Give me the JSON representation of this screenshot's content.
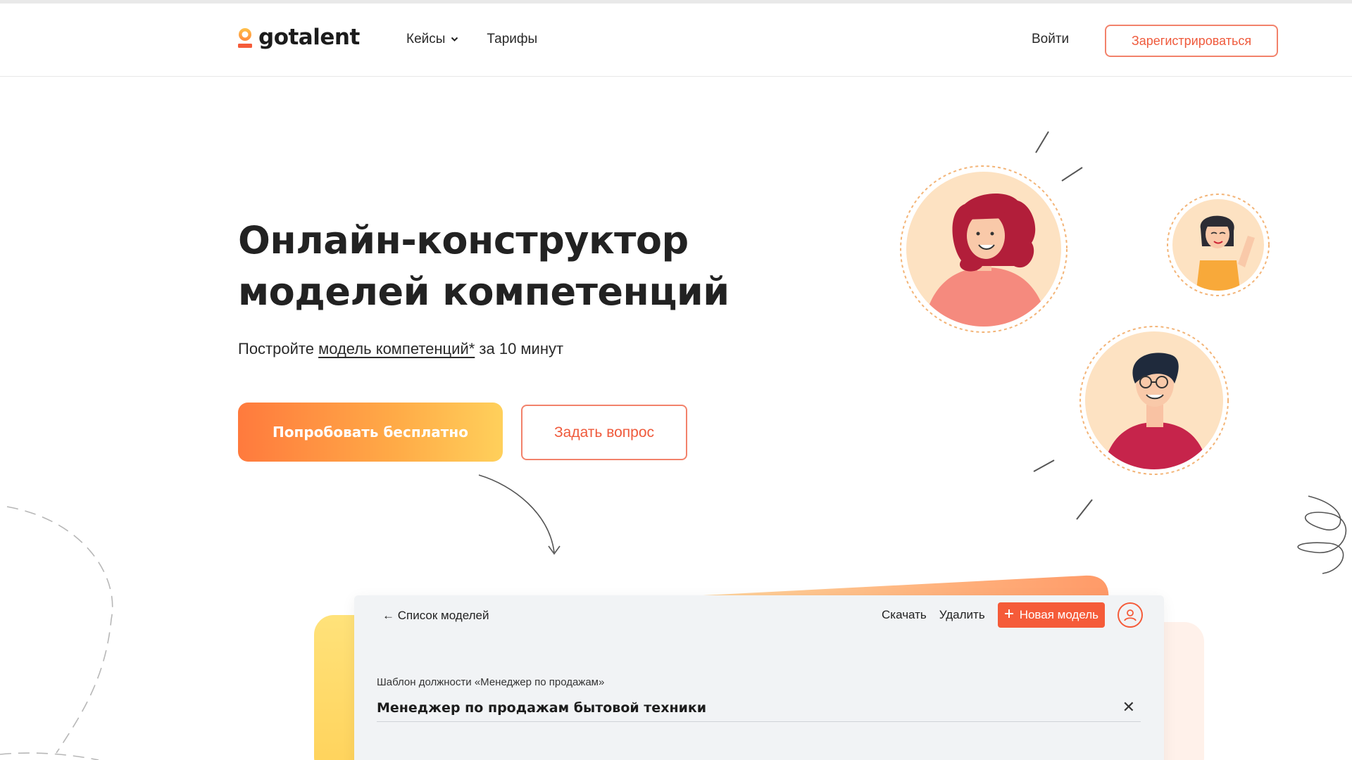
{
  "header": {
    "logo_text": "gotalent",
    "nav": [
      {
        "label": "Кейсы",
        "has_dropdown": true
      },
      {
        "label": "Тарифы",
        "has_dropdown": false
      }
    ],
    "login_label": "Войти",
    "register_label": "Зарегистрироваться"
  },
  "hero": {
    "title_line1": "Онлайн-конструктор",
    "title_line2": "моделей компетенций",
    "subtitle_prefix": "Постройте ",
    "subtitle_link": "модель компетенций*",
    "subtitle_suffix": " за 10 минут",
    "primary_button": "Попробовать бесплатно",
    "secondary_button": "Задать вопрос"
  },
  "app_preview": {
    "back_link": "← Список моделей",
    "download_label": "Скачать",
    "delete_label": "Удалить",
    "new_model_label": "Новая модель",
    "template_label": "Шаблон должности «Менеджер по продажам»",
    "position_value": "Менеджер по продажам бытовой техники",
    "close_symbol": "✕"
  },
  "colors": {
    "accent": "#ef5a3c",
    "accent_border": "#f2826b",
    "gradient_start": "#ff7a3d",
    "gradient_end": "#ffd05b",
    "text_dark": "#222222"
  },
  "icons": [
    "logo-mark-icon",
    "chevron-down-icon",
    "plus-icon",
    "user-icon",
    "close-icon",
    "arrow-left-icon"
  ]
}
